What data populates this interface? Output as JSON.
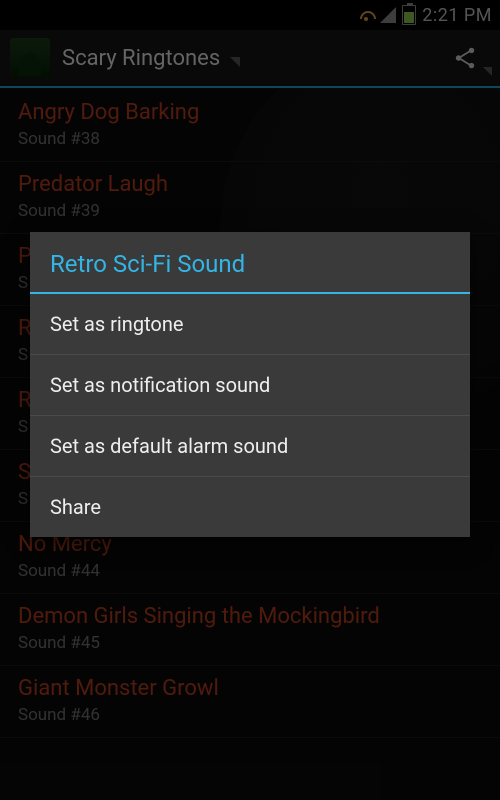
{
  "status": {
    "time": "2:21 PM"
  },
  "header": {
    "title": "Scary Ringtones"
  },
  "list": {
    "items": [
      {
        "title": "Angry Dog Barking",
        "sub": "Sound #38"
      },
      {
        "title": "Predator Laugh",
        "sub": "Sound #39"
      },
      {
        "title": "P",
        "sub": "S"
      },
      {
        "title": "R",
        "sub": "S"
      },
      {
        "title": "R",
        "sub": "S"
      },
      {
        "title": "S",
        "sub": "S"
      },
      {
        "title": "No Mercy",
        "sub": "Sound #44"
      },
      {
        "title": "Demon Girls Singing the Mockingbird",
        "sub": "Sound #45"
      },
      {
        "title": "Giant Monster Growl",
        "sub": "Sound #46"
      }
    ]
  },
  "dialog": {
    "title": "Retro Sci-Fi Sound",
    "options": [
      "Set as ringtone",
      "Set as notification sound",
      "Set as default alarm sound",
      "Share"
    ]
  },
  "colors": {
    "accent": "#33b5e5",
    "item_title": "#b23a1c"
  }
}
